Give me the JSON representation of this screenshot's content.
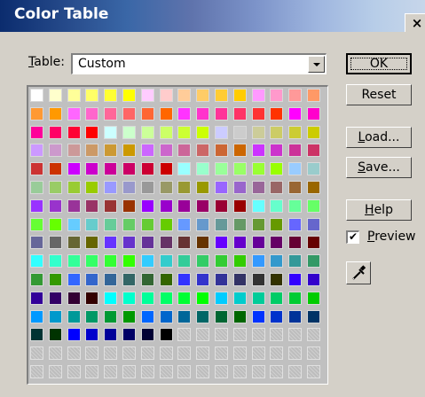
{
  "window": {
    "title": "Color Table",
    "close_glyph": "×"
  },
  "table": {
    "label_key": "T",
    "label_rest": "able:",
    "selected": "Custom"
  },
  "buttons": {
    "ok": "OK",
    "reset": "Reset",
    "load": [
      "L",
      "oad..."
    ],
    "save": [
      "S",
      "ave..."
    ],
    "help": [
      "H",
      "elp"
    ]
  },
  "preview": {
    "label_key": "P",
    "label_rest": "review",
    "checked": true,
    "check_glyph": "✔"
  },
  "icons": {
    "eyedropper": "eyedropper-icon",
    "dropdown": "chevron-down-icon"
  },
  "swatches": [
    "#ffffff",
    "#ffffcc",
    "#ffff99",
    "#ffff66",
    "#ffff33",
    "#ffff00",
    "#ffccff",
    "#ffcccc",
    "#ffcc99",
    "#ffcc66",
    "#ffcc33",
    "#ffcc00",
    "#ff99ff",
    "#ff99cc",
    "#ff9999",
    "#ff9966",
    "#ff9933",
    "#ff9900",
    "#ff66ff",
    "#ff66cc",
    "#ff6699",
    "#ff6666",
    "#ff6633",
    "#ff6600",
    "#ff33ff",
    "#ff33cc",
    "#ff3399",
    "#ff3366",
    "#ff3333",
    "#ff3300",
    "#ff00ff",
    "#ff00cc",
    "#ff0099",
    "#ff0066",
    "#ff0033",
    "#ff0000",
    "#ccffff",
    "#ccffcc",
    "#ccff99",
    "#ccff66",
    "#ccff33",
    "#ccff00",
    "#ccccff",
    "#cccccc",
    "#cccc99",
    "#cccc66",
    "#cccc33",
    "#cccc00",
    "#cc99ff",
    "#cc99cc",
    "#cc9999",
    "#cc9966",
    "#cc9933",
    "#cc9900",
    "#cc66ff",
    "#cc66cc",
    "#cc6699",
    "#cc6666",
    "#cc6633",
    "#cc6600",
    "#cc33ff",
    "#cc33cc",
    "#cc3399",
    "#cc3366",
    "#cc3333",
    "#cc3300",
    "#cc00ff",
    "#cc00cc",
    "#cc0099",
    "#cc0066",
    "#cc0033",
    "#cc0000",
    "#99ffff",
    "#99ffcc",
    "#99ff99",
    "#99ff66",
    "#99ff33",
    "#99ff00",
    "#99ccff",
    "#99cccc",
    "#99cc99",
    "#99cc66",
    "#99cc33",
    "#99cc00",
    "#9999ff",
    "#9999cc",
    "#999999",
    "#999966",
    "#999933",
    "#999900",
    "#9966ff",
    "#9966cc",
    "#996699",
    "#996666",
    "#996633",
    "#996600",
    "#9933ff",
    "#9933cc",
    "#993399",
    "#993366",
    "#993333",
    "#993300",
    "#9900ff",
    "#9900cc",
    "#990099",
    "#990066",
    "#990033",
    "#990000",
    "#66ffff",
    "#66ffcc",
    "#66ff99",
    "#66ff66",
    "#66ff33",
    "#66ff00",
    "#66ccff",
    "#66cccc",
    "#66cc99",
    "#66cc66",
    "#66cc33",
    "#66cc00",
    "#6699ff",
    "#6699cc",
    "#669999",
    "#669966",
    "#669933",
    "#669900",
    "#6666ff",
    "#6666cc",
    "#666699",
    "#666666",
    "#666633",
    "#666600",
    "#6633ff",
    "#6633cc",
    "#663399",
    "#663366",
    "#663333",
    "#663300",
    "#6600ff",
    "#6600cc",
    "#660099",
    "#660066",
    "#660033",
    "#660000",
    "#33ffff",
    "#33ffcc",
    "#33ff99",
    "#33ff66",
    "#33ff33",
    "#33ff00",
    "#33ccff",
    "#33cccc",
    "#33cc99",
    "#33cc66",
    "#33cc33",
    "#33cc00",
    "#3399ff",
    "#3399cc",
    "#339999",
    "#339966",
    "#339933",
    "#339900",
    "#3366ff",
    "#3366cc",
    "#336699",
    "#336666",
    "#336633",
    "#336600",
    "#3333ff",
    "#3333cc",
    "#333399",
    "#333366",
    "#333333",
    "#333300",
    "#3300ff",
    "#3300cc",
    "#330099",
    "#330066",
    "#330033",
    "#330000",
    "#00ffff",
    "#00ffcc",
    "#00ff99",
    "#00ff66",
    "#00ff33",
    "#00ff00",
    "#00ccff",
    "#00cccc",
    "#00cc99",
    "#00cc66",
    "#00cc33",
    "#00cc00",
    "#0099ff",
    "#0099cc",
    "#009999",
    "#009966",
    "#009933",
    "#009900",
    "#0066ff",
    "#0066cc",
    "#006699",
    "#006666",
    "#006633",
    "#006600",
    "#0033ff",
    "#0033cc",
    "#003399",
    "#003366",
    "#003333",
    "#003300",
    "#0000ff",
    "#0000cc",
    "#000099",
    "#000066",
    "#000033",
    "#000000"
  ],
  "empty_swatches": 40
}
